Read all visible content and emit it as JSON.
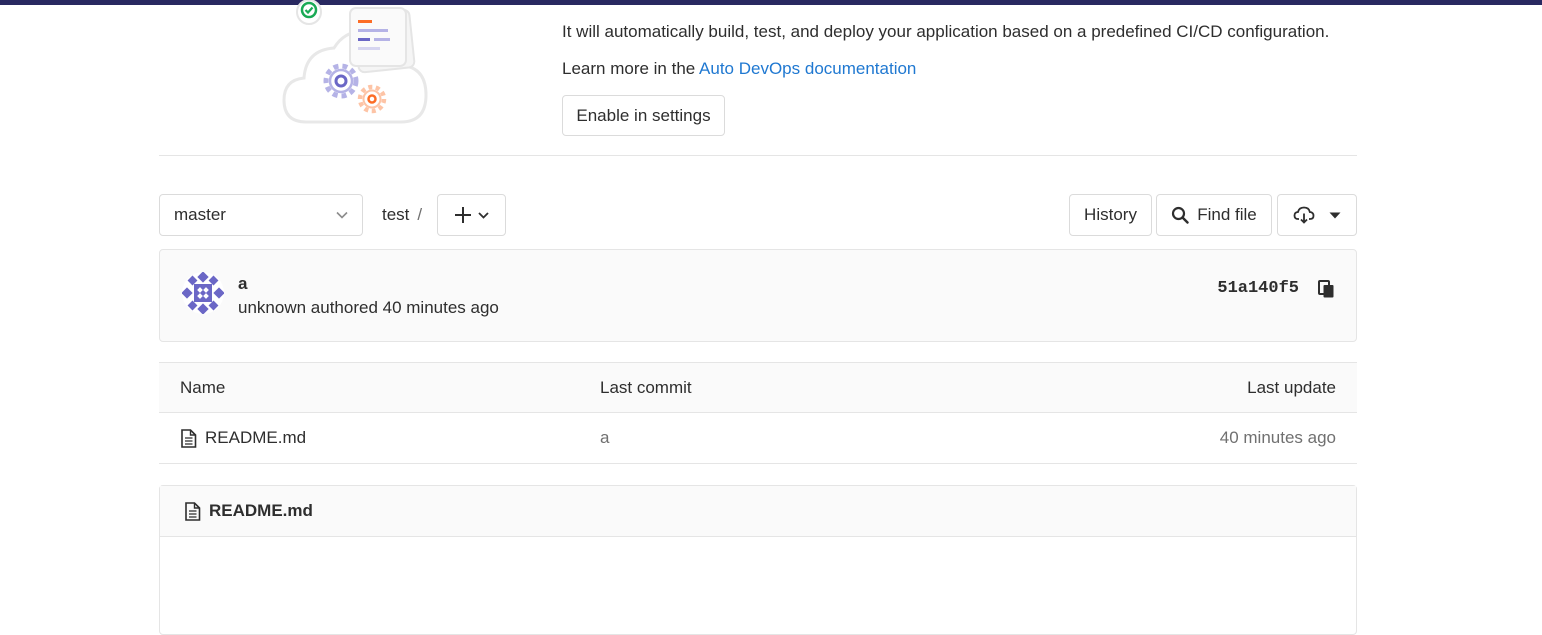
{
  "banner": {
    "line1": "It will automatically build, test, and deploy your application based on a predefined CI/CD configuration.",
    "learn_more_prefix": "Learn more in the ",
    "learn_more_link": "Auto DevOps documentation",
    "enable_button": "Enable in settings"
  },
  "tree": {
    "branch": "master",
    "path": "test",
    "path_separator": "/",
    "history_button": "History",
    "find_file_button": "Find file"
  },
  "commit": {
    "title": "a",
    "author": "unknown",
    "authored_text": "authored 40 minutes ago",
    "sha": "51a140f5"
  },
  "files": {
    "headers": {
      "name": "Name",
      "last_commit": "Last commit",
      "last_update": "Last update"
    },
    "rows": [
      {
        "name": "README.md",
        "last_commit": "a",
        "last_update": "40 minutes ago"
      }
    ]
  },
  "readme": {
    "title": "README.md"
  },
  "colors": {
    "topbar": "#292961",
    "link": "#1f78d1",
    "avatar": "#6b67c6"
  }
}
